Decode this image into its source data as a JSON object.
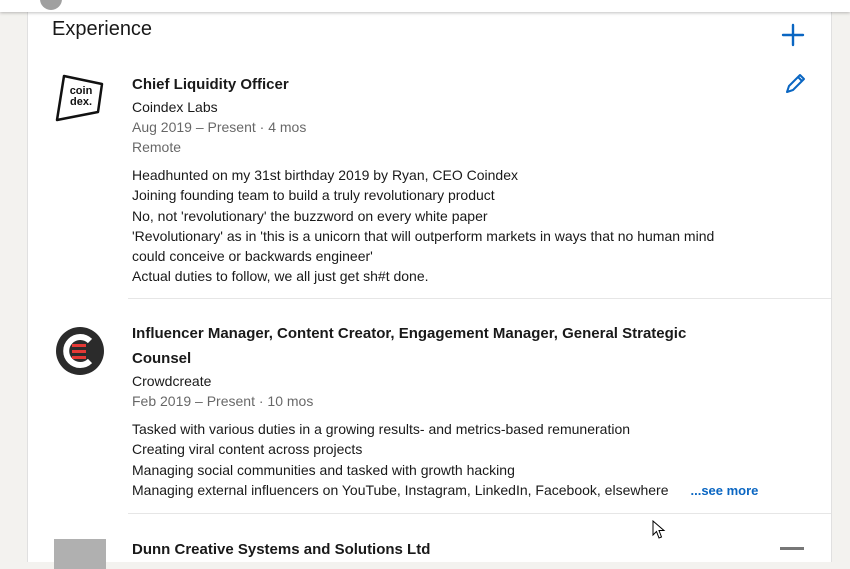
{
  "section": {
    "title": "Experience"
  },
  "jobs": [
    {
      "title": "Chief Liquidity Officer",
      "company": "Coindex Labs",
      "dates": "Aug 2019 – Present · 4 mos",
      "location": "Remote",
      "logo_text": [
        "coin",
        "dex."
      ],
      "description": [
        "Headhunted on my 31st birthday 2019 by Ryan, CEO Coindex",
        "Joining founding team to build a truly revolutionary product",
        "No, not 'revolutionary' the buzzword on every white paper",
        "'Revolutionary' as in 'this is a unicorn that will outperform markets in ways that no human mind",
        "could conceive or backwards engineer'",
        "Actual duties to follow, we all just get sh#t done."
      ]
    },
    {
      "title_line1": "Influencer Manager, Content Creator, Engagement Manager, General Strategic",
      "title_line2": "Counsel",
      "company": "Crowdcreate",
      "dates": "Feb 2019 – Present · 10 mos",
      "description": [
        "Tasked with various duties in a growing results- and metrics-based remuneration",
        "Creating viral content across projects",
        "Managing social communities and tasked with growth hacking",
        "Managing external influencers on YouTube, Instagram, LinkedIn, Facebook, elsewhere"
      ],
      "see_more": "...see more"
    },
    {
      "title": "Dunn Creative Systems and Solutions Ltd"
    }
  ],
  "colors": {
    "accent": "#0a66c2",
    "crowdcreate_red": "#e53935"
  }
}
